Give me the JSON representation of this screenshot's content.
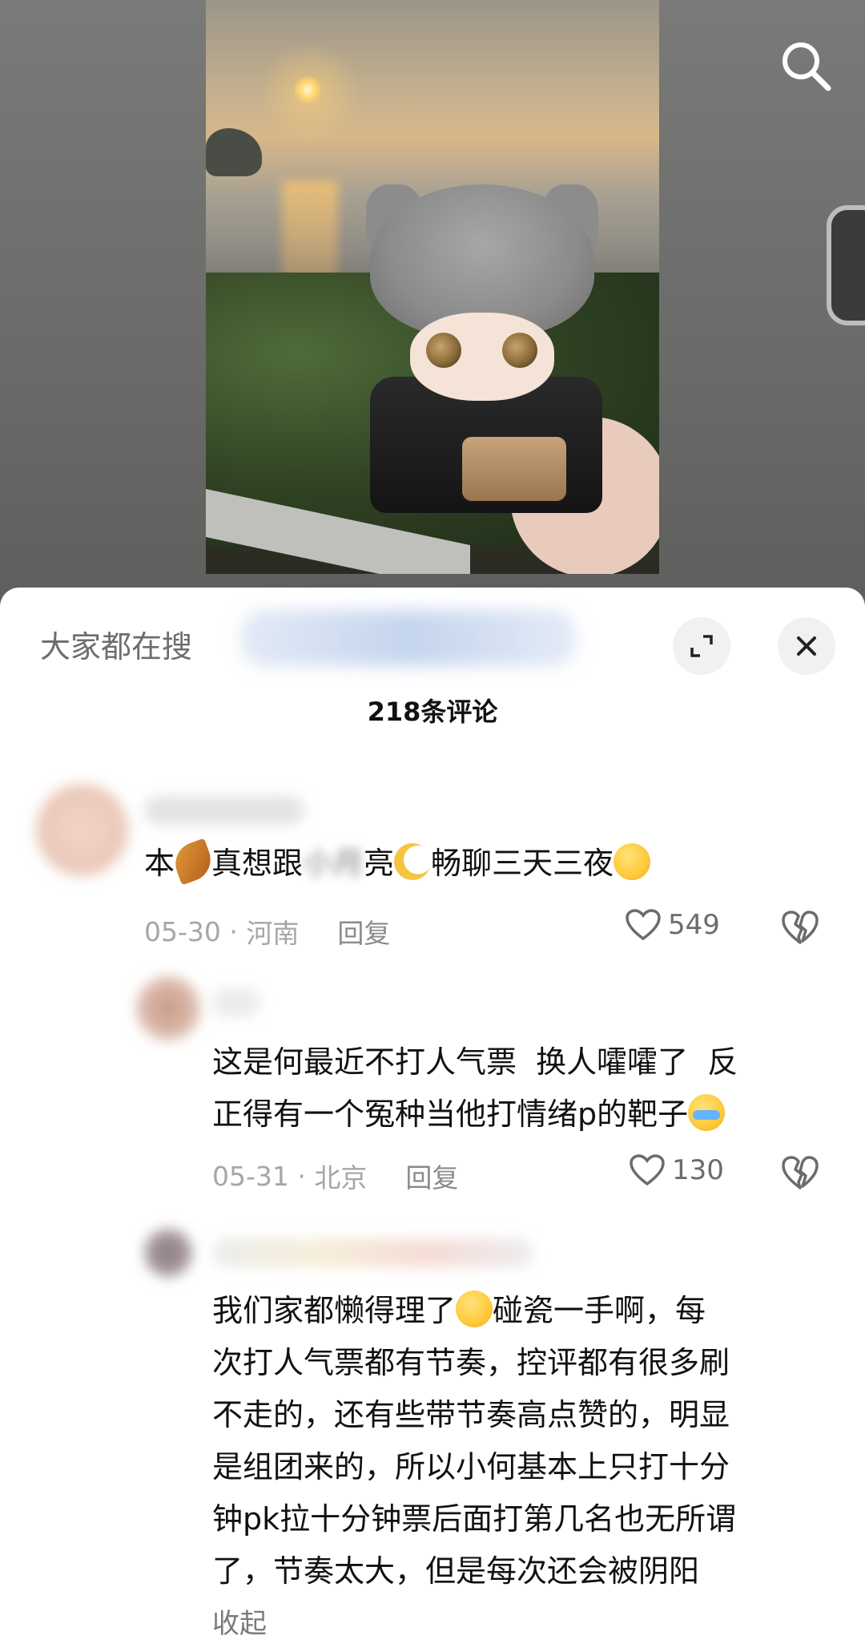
{
  "top": {
    "search_icon": "search-icon",
    "side_tab_icon": "side-panel-tab"
  },
  "sheet": {
    "search_prefix": "大家都在搜",
    "expand_icon": "expand-icon",
    "close_icon": "close-icon",
    "comment_count": "218条评论"
  },
  "comments": [
    {
      "text_before": "本",
      "text_mid1": "真想跟",
      "text_blurred": "小月",
      "text_mid2": "亮",
      "text_after": "畅聊三天三夜",
      "date": "05-30",
      "region": "河南",
      "reply_label": "回复",
      "likes": "549"
    },
    {
      "text_line1": "这是何最近不打人气票  换人嚯嚯了  反",
      "text_line2": "正得有一个冤种当他打情绪p的靶子",
      "date": "05-31",
      "region": "北京",
      "reply_label": "回复",
      "likes": "130"
    },
    {
      "text_line1a": "我们家都懒得理了",
      "text_line1b": "碰瓷一手啊，每",
      "text_line2": "次打人气票都有节奏，控评都有很多刷",
      "text_line3": "不走的，还有些带节奏高点赞的，明显",
      "text_line4": "是组团来的，所以小何基本上只打十分",
      "text_line5": "钟pk拉十分钟票后面打第几名也无所谓",
      "text_line6": "了，节奏太大，但是每次还会被阴阳",
      "collapse_label": "收起"
    }
  ],
  "colors": {
    "sheet_bg": "#ffffff",
    "meta_gray": "#a6a6a6",
    "text": "#111111"
  }
}
